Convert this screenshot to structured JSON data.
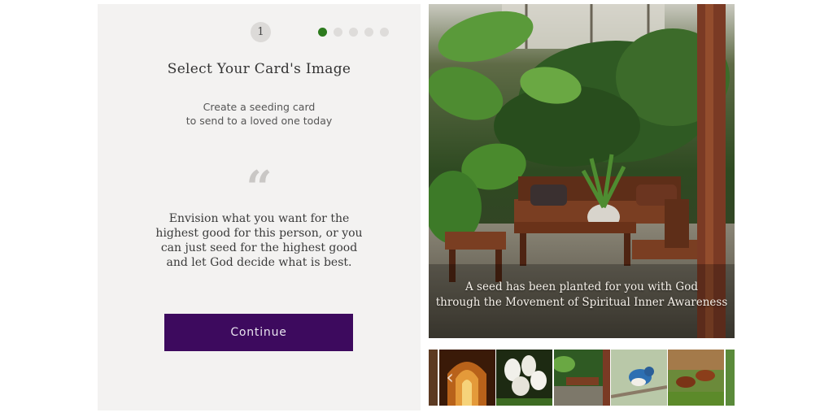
{
  "wizard": {
    "step_number": "1",
    "total_steps": 5,
    "current_step": 1,
    "title": "Select Your Card's Image",
    "subtitle_lines": [
      "Create a seeding card",
      "to send to a loved one today"
    ],
    "quote_glyph": "“",
    "body_lines": [
      "Envision what you want for the",
      "highest good for this person, or you",
      "can just seed for the highest good",
      "and let God decide what is best."
    ],
    "continue_label": "Continue"
  },
  "preview": {
    "caption_lines": [
      "A seed has been planted for you with God",
      "through the Movement of Spiritual Inner Awareness"
    ]
  },
  "thumbnails": {
    "prev_arrow_glyph": "‹",
    "items": [
      {
        "name": "thumb-partial-left"
      },
      {
        "name": "thumb-arch-corridor"
      },
      {
        "name": "thumb-white-flowers"
      },
      {
        "name": "thumb-garden-patio"
      },
      {
        "name": "thumb-blue-bird"
      },
      {
        "name": "thumb-horses"
      },
      {
        "name": "thumb-partial-right"
      }
    ]
  },
  "colors": {
    "panel_bg": "#f3f2f1",
    "accent_button": "#3d0a5e",
    "active_dot": "#2c7a1d",
    "inactive_dot": "#dedcda"
  }
}
